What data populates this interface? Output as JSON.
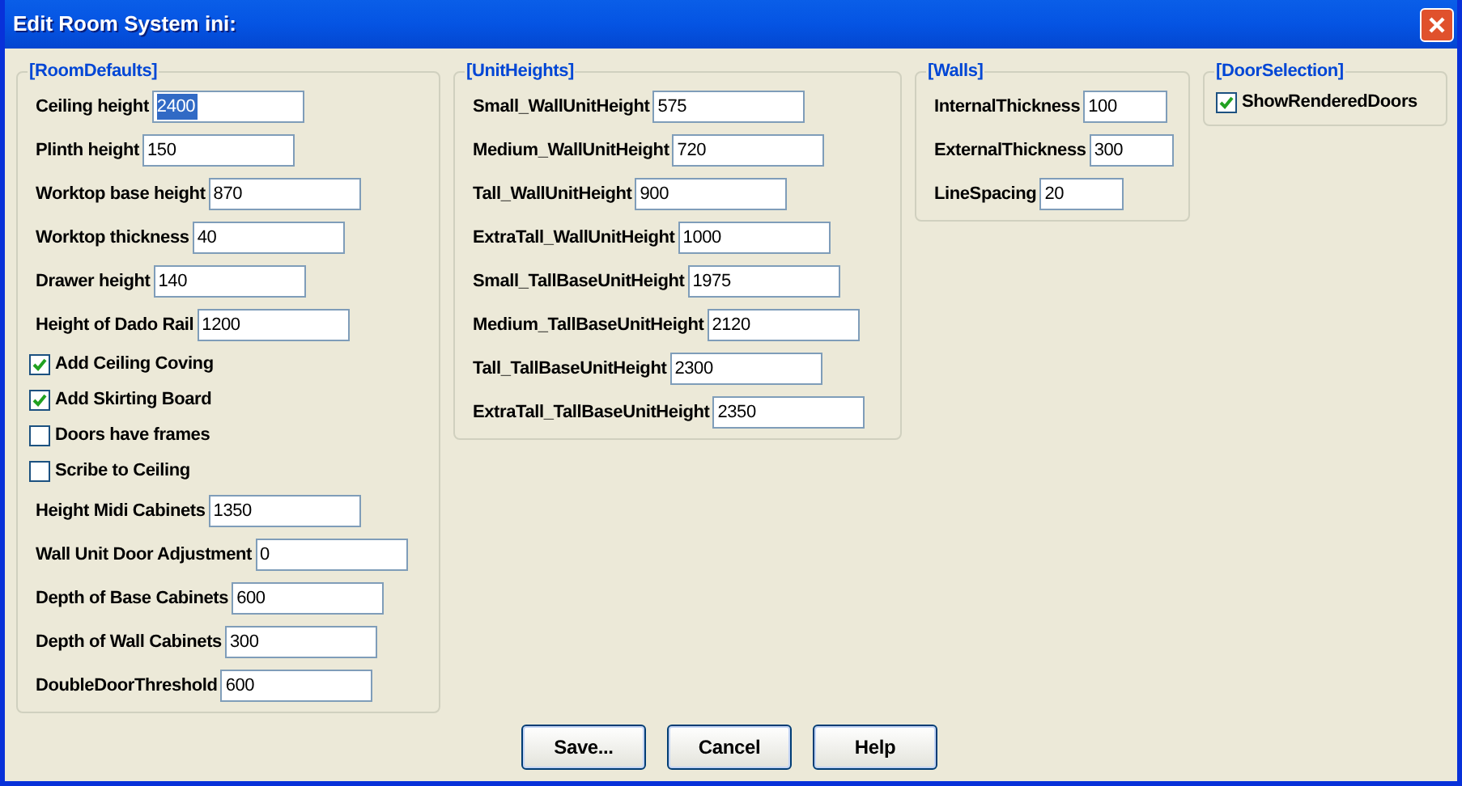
{
  "window": {
    "title": "Edit Room System ini:"
  },
  "groups": [
    {
      "title": "[RoomDefaults]",
      "items": [
        {
          "kind": "field",
          "label": "Ceiling height",
          "value": "2400",
          "selected": true
        },
        {
          "kind": "field",
          "label": "Plinth height",
          "value": "150",
          "selected": false
        },
        {
          "kind": "field",
          "label": "Worktop base height",
          "value": "870",
          "selected": false
        },
        {
          "kind": "field",
          "label": "Worktop thickness",
          "value": "40",
          "selected": false
        },
        {
          "kind": "field",
          "label": "Drawer height",
          "value": "140",
          "selected": false
        },
        {
          "kind": "field",
          "label": "Height of Dado Rail",
          "value": "1200",
          "selected": false
        },
        {
          "kind": "checkbox",
          "label": "Add Ceiling Coving",
          "checked": true
        },
        {
          "kind": "checkbox",
          "label": "Add Skirting Board",
          "checked": true
        },
        {
          "kind": "checkbox",
          "label": "Doors have frames",
          "checked": false
        },
        {
          "kind": "checkbox",
          "label": "Scribe to Ceiling",
          "checked": false
        },
        {
          "kind": "field",
          "label": "Height Midi Cabinets",
          "value": "1350",
          "selected": false
        },
        {
          "kind": "field",
          "label": "Wall Unit Door Adjustment",
          "value": "0",
          "selected": false
        },
        {
          "kind": "field",
          "label": "Depth of Base Cabinets",
          "value": "600",
          "selected": false
        },
        {
          "kind": "field",
          "label": "Depth of Wall Cabinets",
          "value": "300",
          "selected": false
        },
        {
          "kind": "field",
          "label": "DoubleDoorThreshold",
          "value": "600",
          "selected": false
        }
      ]
    },
    {
      "title": "[UnitHeights]",
      "items": [
        {
          "kind": "field",
          "label": "Small_WallUnitHeight",
          "value": "575",
          "selected": false
        },
        {
          "kind": "field",
          "label": "Medium_WallUnitHeight",
          "value": "720",
          "selected": false
        },
        {
          "kind": "field",
          "label": "Tall_WallUnitHeight",
          "value": "900",
          "selected": false
        },
        {
          "kind": "field",
          "label": "ExtraTall_WallUnitHeight",
          "value": "1000",
          "selected": false
        },
        {
          "kind": "field",
          "label": "Small_TallBaseUnitHeight",
          "value": "1975",
          "selected": false
        },
        {
          "kind": "field",
          "label": "Medium_TallBaseUnitHeight",
          "value": "2120",
          "selected": false
        },
        {
          "kind": "field",
          "label": "Tall_TallBaseUnitHeight",
          "value": "2300",
          "selected": false
        },
        {
          "kind": "field",
          "label": "ExtraTall_TallBaseUnitHeight",
          "value": "2350",
          "selected": false
        }
      ]
    },
    {
      "title": "[Walls]",
      "items": [
        {
          "kind": "field",
          "label": "InternalThickness",
          "value": "100",
          "selected": false
        },
        {
          "kind": "field",
          "label": "ExternalThickness",
          "value": "300",
          "selected": false
        },
        {
          "kind": "field",
          "label": "LineSpacing",
          "value": "20",
          "selected": false
        }
      ]
    },
    {
      "title": "[DoorSelection]",
      "items": [
        {
          "kind": "checkbox",
          "label": "ShowRenderedDoors",
          "checked": true
        }
      ]
    }
  ],
  "buttons": [
    "Save...",
    "Cancel",
    "Help"
  ]
}
